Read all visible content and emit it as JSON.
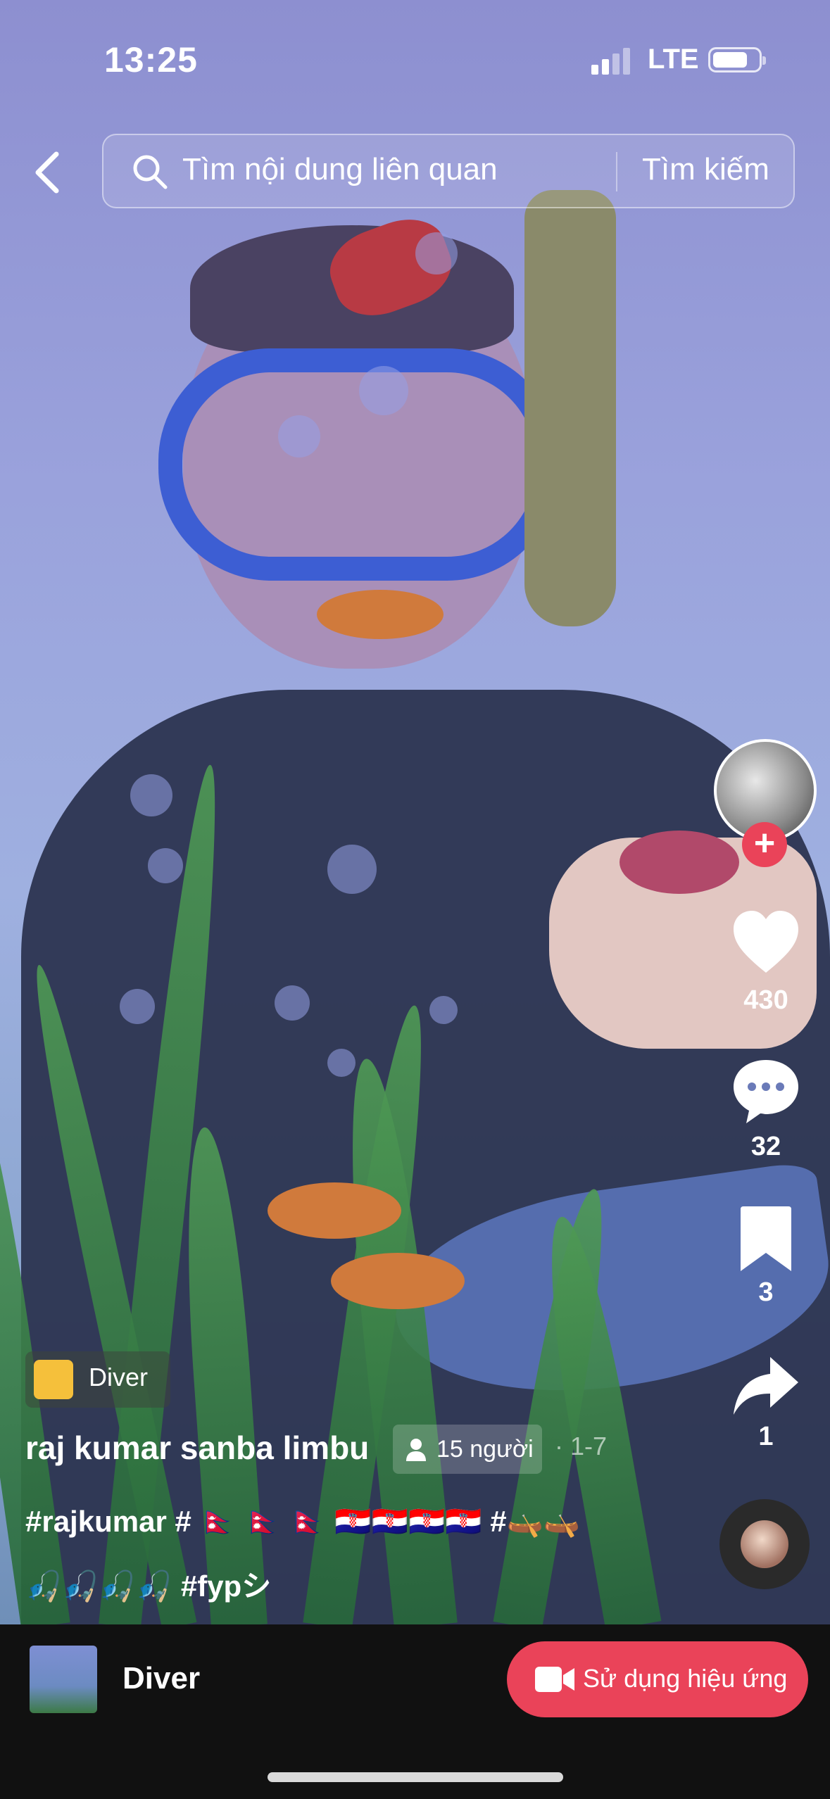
{
  "status_bar": {
    "time": "13:25",
    "network": "LTE"
  },
  "search": {
    "placeholder": "Tìm nội dung liên quan",
    "button": "Tìm kiếm"
  },
  "actions": {
    "likes": "430",
    "comments": "32",
    "saves": "3",
    "shares": "1"
  },
  "effect": {
    "name": "Diver"
  },
  "post": {
    "author": "raj kumar sanba limbu",
    "people": "15 người",
    "date": "· 1-7",
    "caption_line1": "#rajkumar # 🇳🇵 🇳🇵 🇳🇵 🇭🇷🇭🇷🇭🇷🇭🇷 #🛶🛶",
    "caption_line2": "🎣🎣🎣🎣 #fypシ"
  },
  "bottom_bar": {
    "effect_name": "Diver",
    "use_button": "Sử dụng hiệu ứng"
  },
  "colors": {
    "accent": "#ea4359",
    "bottom_bar": "#111111",
    "video_bg": "#9aa2dc"
  }
}
